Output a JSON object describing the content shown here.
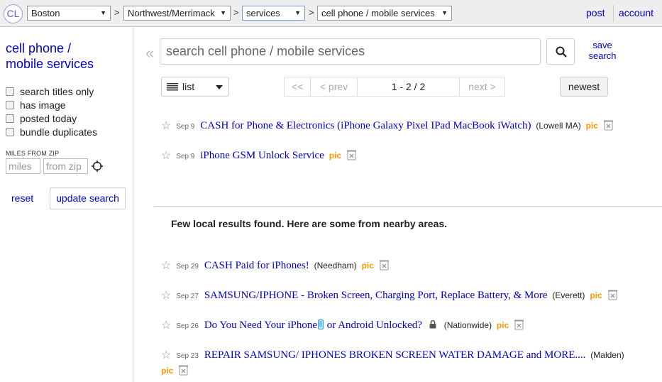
{
  "header": {
    "logo": "CL",
    "area": "Boston",
    "subarea": "Northwest/Merrimack",
    "section": "services",
    "category": "cell phone / mobile services",
    "post_label": "post",
    "account_label": "account"
  },
  "sidebar": {
    "category_title_line1": "cell phone /",
    "category_title_line2": "mobile services",
    "filters": [
      {
        "label": "search titles only",
        "checked": false
      },
      {
        "label": "has image",
        "checked": false
      },
      {
        "label": "posted today",
        "checked": false
      },
      {
        "label": "bundle duplicates",
        "checked": false
      }
    ],
    "miles_from_zip_label": "MILES FROM ZIP",
    "miles_placeholder": "miles",
    "zip_placeholder": "from zip",
    "reset_label": "reset",
    "update_label": "update search"
  },
  "search": {
    "placeholder": "search cell phone / mobile services",
    "save_line1": "save",
    "save_line2": "search"
  },
  "toolbar": {
    "view_label": "list",
    "first_label": "<<",
    "prev_label": "< prev",
    "range_label": "1 - 2 / 2",
    "next_label": "next >",
    "sort_label": "newest"
  },
  "results": [
    {
      "date": "Sep 9",
      "title": "CASH for Phone & Electronics (iPhone Galaxy Pixel IPad MacBook iWatch)",
      "location": "(Lowell MA)",
      "pic": "pic"
    },
    {
      "date": "Sep 9",
      "title": "iPhone GSM Unlock Service",
      "location": "",
      "pic": "pic"
    }
  ],
  "nearby_message": "Few local results found. Here are some from nearby areas.",
  "nearby_results": [
    {
      "date": "Sep 29",
      "title": "CASH Paid for iPhones!",
      "location": "(Needham)",
      "pic": "pic"
    },
    {
      "date": "Sep 27",
      "title": "SAMSUNG/IPHONE - Broken Screen, Charging Port, Replace Battery, & More",
      "location": "(Everett)",
      "pic": "pic"
    },
    {
      "date": "Sep 26",
      "title_part1": "Do You Need Your iPhone",
      "title_part2": " or Android Unlocked?",
      "location": "(Nationwide)",
      "pic": "pic"
    },
    {
      "date": "Sep 23",
      "title": "REPAIR SAMSUNG/ IPHONES BROKEN SCREEN WATER DAMAGE and MORE....",
      "location": "(Malden)",
      "pic": "pic"
    }
  ],
  "colors": {
    "link": "#0000cc",
    "pic": "#ff9900",
    "topbar_bg": "#eeeeee"
  }
}
